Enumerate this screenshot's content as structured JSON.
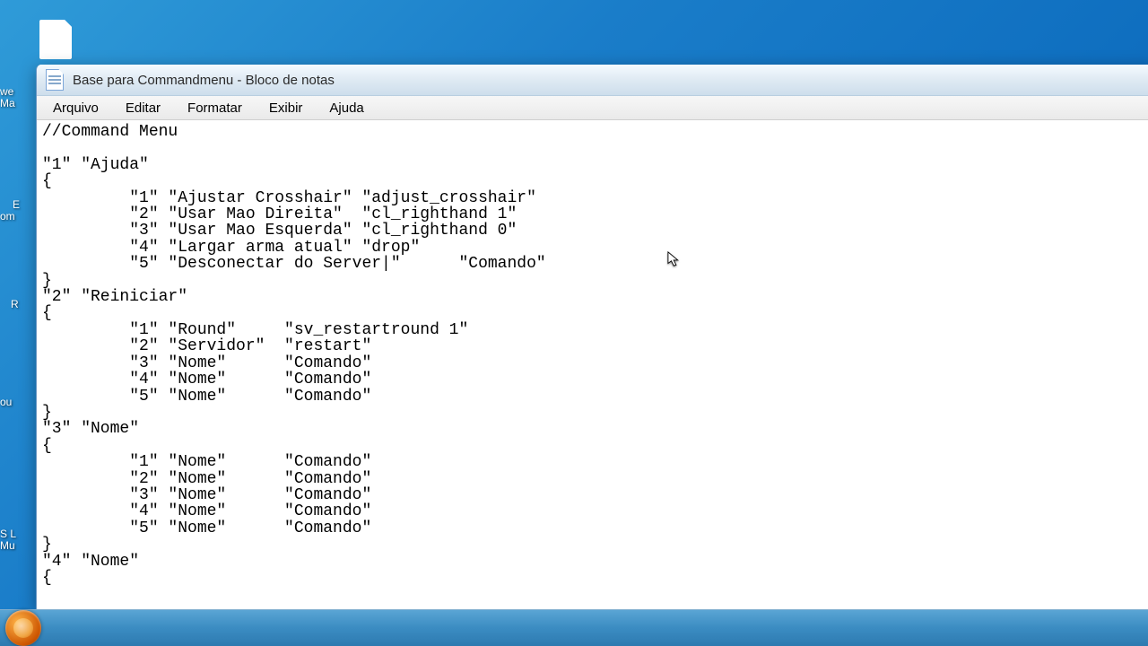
{
  "window": {
    "title": "Base para Commandmenu - Bloco de notas"
  },
  "menu": {
    "file": "Arquivo",
    "edit": "Editar",
    "format": "Formatar",
    "view": "Exibir",
    "help": "Ajuda"
  },
  "desktop_labels": {
    "l1a": "we",
    "l1b": "Ma",
    "l2a": "E",
    "l2b": "om",
    "l3": "R",
    "l4": "ou",
    "l5a": "S L",
    "l5b": "Mu"
  },
  "editor_text": "//Command Menu\n\n\"1\" \"Ajuda\"\n{\n         \"1\" \"Ajustar Crosshair\" \"adjust_crosshair\"\n         \"2\" \"Usar Mao Direita\"  \"cl_righthand 1\"\n         \"3\" \"Usar Mao Esquerda\" \"cl_righthand 0\"\n         \"4\" \"Largar arma atual\" \"drop\"\n         \"5\" \"Desconectar do Server|\"      \"Comando\"\n}\n\"2\" \"Reiniciar\"\n{\n         \"1\" \"Round\"     \"sv_restartround 1\"\n         \"2\" \"Servidor\"  \"restart\"\n         \"3\" \"Nome\"      \"Comando\"\n         \"4\" \"Nome\"      \"Comando\"\n         \"5\" \"Nome\"      \"Comando\"\n}\n\"3\" \"Nome\"\n{\n         \"1\" \"Nome\"      \"Comando\"\n         \"2\" \"Nome\"      \"Comando\"\n         \"3\" \"Nome\"      \"Comando\"\n         \"4\" \"Nome\"      \"Comando\"\n         \"5\" \"Nome\"      \"Comando\"\n}\n\"4\" \"Nome\"\n{"
}
